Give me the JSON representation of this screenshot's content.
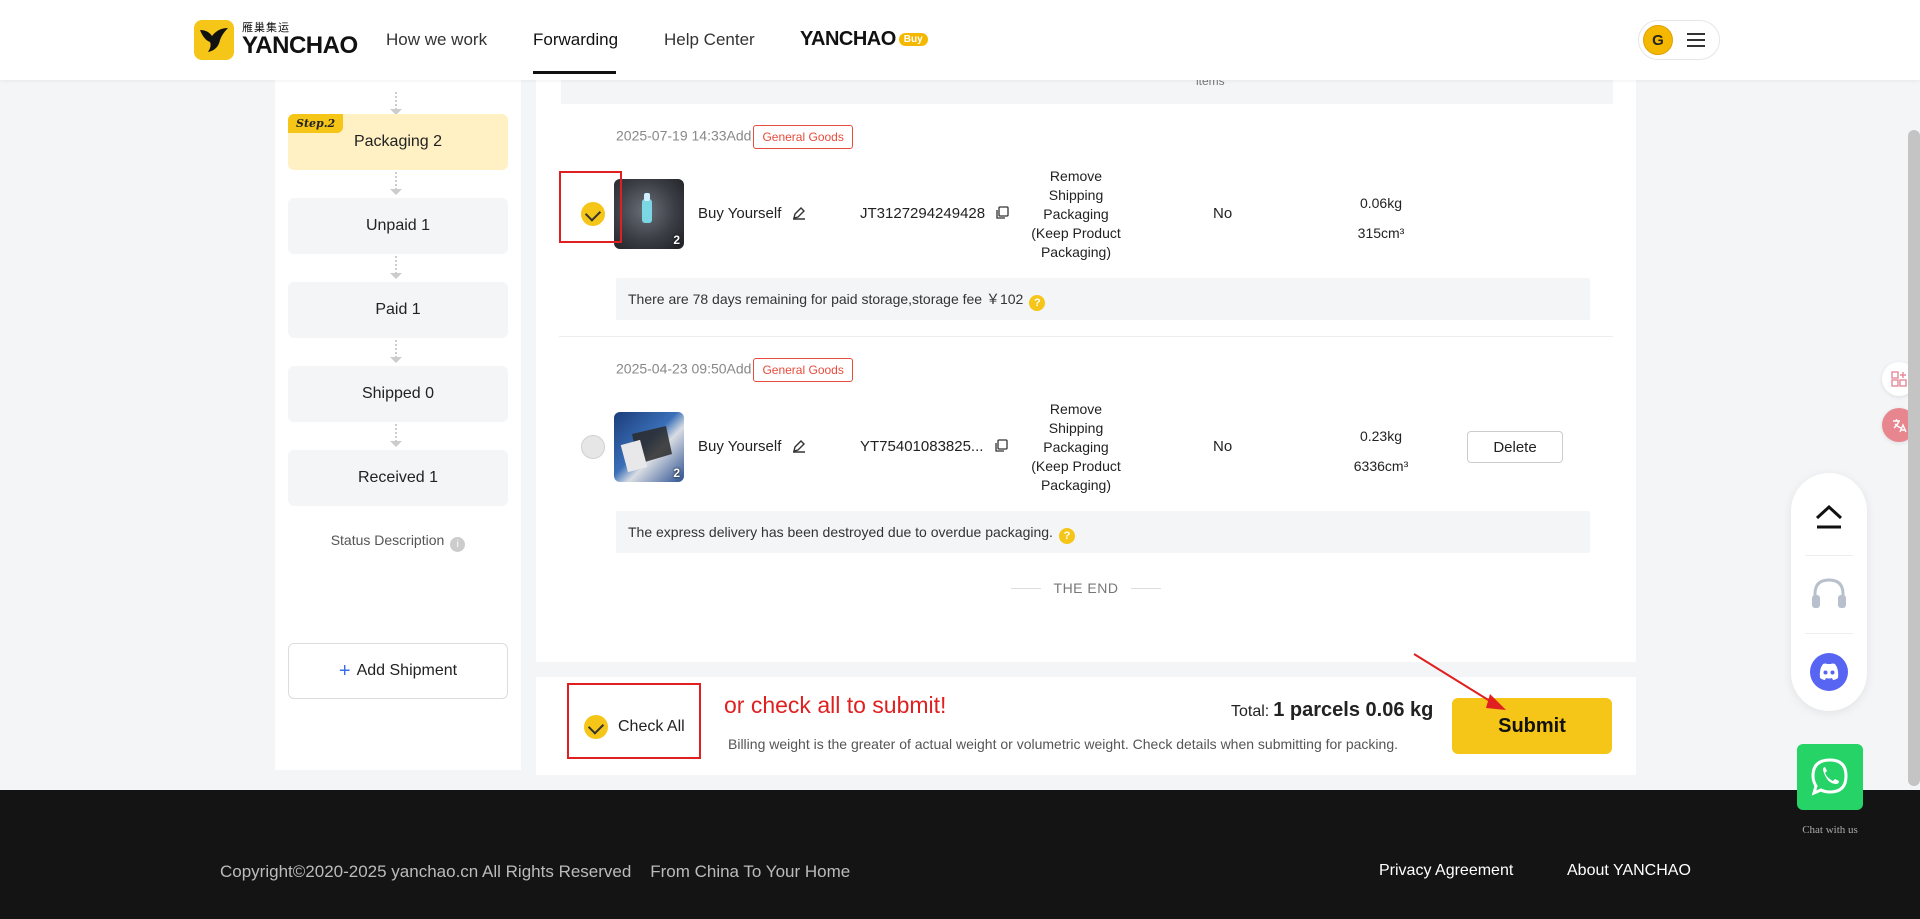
{
  "header": {
    "logo_cn": "雁巢集运",
    "logo_en": "YANCHAO",
    "nav": [
      "How we work",
      "Forwarding",
      "Help Center"
    ],
    "brand_word": "YANCHAO",
    "brand_badge": "Buy",
    "avatar_letter": "G"
  },
  "sidebar": {
    "step_tag": "Step.2",
    "steps": [
      {
        "label": "Packaging 2",
        "active": true
      },
      {
        "label": "Unpaid 1",
        "active": false
      },
      {
        "label": "Paid 1",
        "active": false
      },
      {
        "label": "Shipped 0",
        "active": false
      },
      {
        "label": "Received 1",
        "active": false
      }
    ],
    "status_description": "Status Description",
    "add_shipment": "Add Shipment"
  },
  "top_strip_text": "items",
  "parcels": [
    {
      "date": "2025-07-19 14:33Add",
      "tag": "General Goods",
      "checked": true,
      "image_count": "2",
      "source": "Buy Yourself",
      "tracking": "JT3127294249428",
      "packaging": [
        "Remove",
        "Shipping",
        "Packaging",
        "(Keep Product",
        "Packaging)"
      ],
      "special": "No",
      "weight": "0.06kg",
      "volume": "315cm³",
      "note": "There are 78 days remaining for paid storage,storage fee ￥102"
    },
    {
      "date": "2025-04-23 09:50Add",
      "tag": "General Goods",
      "checked": false,
      "image_count": "2",
      "source": "Buy Yourself",
      "tracking": "YT75401083825...",
      "packaging": [
        "Remove",
        "Shipping",
        "Packaging",
        "(Keep Product",
        "Packaging)"
      ],
      "special": "No",
      "weight": "0.23kg",
      "volume": "6336cm³",
      "delete_label": "Delete",
      "note": "The express delivery has been destroyed due to overdue packaging."
    }
  ],
  "the_end": "THE END",
  "bottom": {
    "check_all": "Check All",
    "annotation": "or check all to submit!",
    "billing_note": "Billing weight is the greater of actual weight or volumetric weight. Check details when submitting for packing.",
    "total_label": "Total:",
    "total_value": "1 parcels 0.06 kg",
    "submit": "Submit"
  },
  "footer": {
    "copyright": "Copyright©2020-2025 yanchao.cn All Rights Reserved    From China To Your Home",
    "privacy": "Privacy Agreement",
    "about": "About YANCHAO"
  },
  "floating": {
    "chat_label": "Chat with us"
  },
  "colors": {
    "accent": "#f5c518",
    "annotation_red": "#e02020",
    "tag_red": "#e74c3c"
  }
}
